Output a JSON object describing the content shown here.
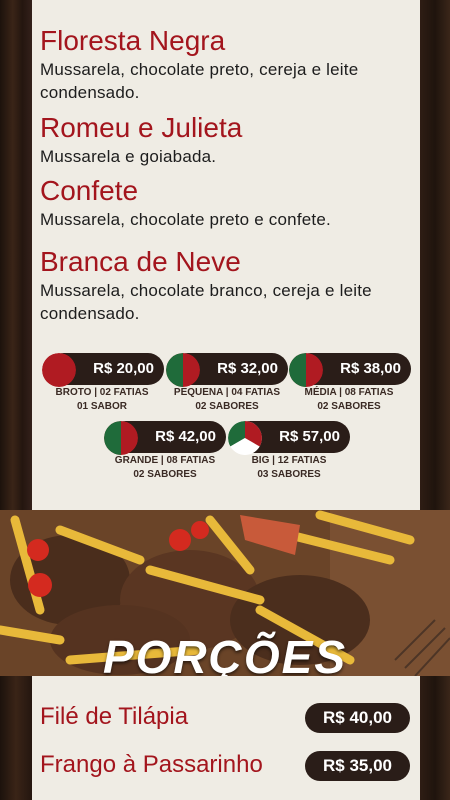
{
  "items": [
    {
      "title": "Floresta Negra",
      "desc": "Mussarela, chocolate preto, cereja e leite condensado."
    },
    {
      "title": "Romeu e Julieta",
      "desc": "Mussarela e goiabada."
    },
    {
      "title": "Confete",
      "desc": "Mussarela, chocolate preto e confete."
    },
    {
      "title": "Branca de Neve",
      "desc": "Mussarela, chocolate branco, cereja e leite condensado."
    }
  ],
  "prices": [
    {
      "value": "R$ 20,00",
      "line1": "BROTO | 02 FATIAS",
      "line2": "01 SABOR"
    },
    {
      "value": "R$ 32,00",
      "line1": "PEQUENA | 04 FATIAS",
      "line2": "02 SABORES"
    },
    {
      "value": "R$ 38,00",
      "line1": "MÉDIA | 08 FATIAS",
      "line2": "02 SABORES"
    },
    {
      "value": "R$ 42,00",
      "line1": "GRANDE | 08 FATIAS",
      "line2": "02 SABORES"
    },
    {
      "value": "R$ 57,00",
      "line1": "BIG | 12 FATIAS",
      "line2": "03 SABORES"
    }
  ],
  "section": {
    "title": "PORÇÕES"
  },
  "portions": [
    {
      "name": "Filé de Tilápia",
      "price": "R$ 40,00"
    },
    {
      "name": "Frango à Passarinho",
      "price": "R$ 35,00"
    }
  ],
  "colors": {
    "accent": "#a3151d",
    "green": "#1f6b3a",
    "dark": "#2a1d18",
    "paper": "#efece4"
  }
}
